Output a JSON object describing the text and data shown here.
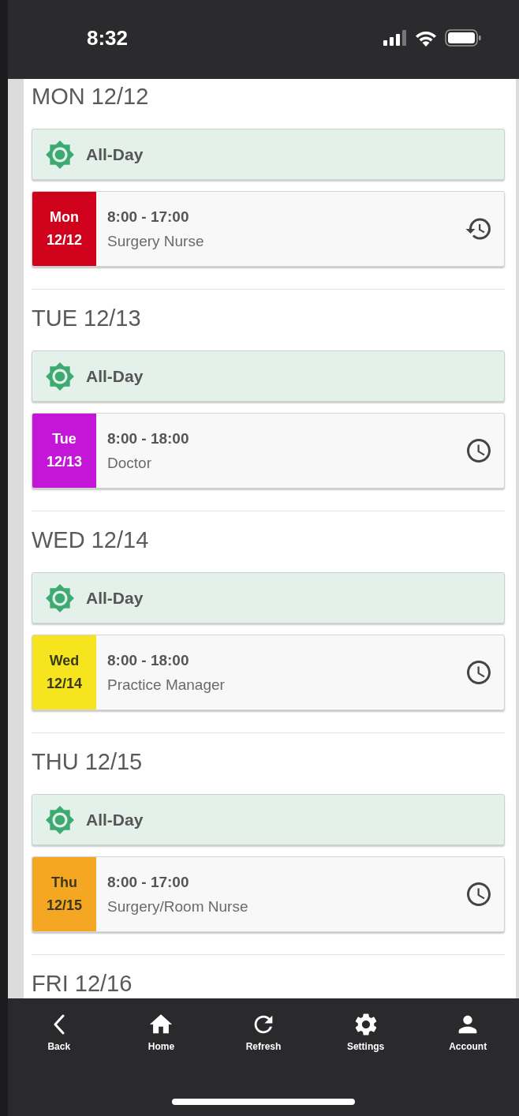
{
  "status_bar": {
    "time": "8:32"
  },
  "days": [
    {
      "heading": "MON 12/12",
      "all_day": {
        "label": "All-Day"
      },
      "shift": {
        "day": "Mon",
        "date": "12/12",
        "color": "#d0021b",
        "time": "8:00 - 17:00",
        "role": "Surgery Nurse",
        "kind": "history"
      }
    },
    {
      "heading": "TUE 12/13",
      "all_day": {
        "label": "All-Day"
      },
      "shift": {
        "day": "Tue",
        "date": "12/13",
        "color": "#c416d6",
        "time": "8:00 - 18:00",
        "role": "Doctor",
        "kind": "clock"
      }
    },
    {
      "heading": "WED 12/14",
      "all_day": {
        "label": "All-Day"
      },
      "shift": {
        "day": "Wed",
        "date": "12/14",
        "color": "#f6e51e",
        "time": "8:00 - 18:00",
        "role": "Practice Manager",
        "kind": "clock"
      }
    },
    {
      "heading": "THU 12/15",
      "all_day": {
        "label": "All-Day"
      },
      "shift": {
        "day": "Thu",
        "date": "12/15",
        "color": "#f5a623",
        "time": "8:00 - 17:00",
        "role": "Surgery/Room Nurse",
        "kind": "clock"
      }
    },
    {
      "heading": "FRI 12/16"
    }
  ],
  "nav": [
    {
      "label": "Back",
      "kind": "back"
    },
    {
      "label": "Home",
      "kind": "home"
    },
    {
      "label": "Refresh",
      "kind": "refresh"
    },
    {
      "label": "Settings",
      "kind": "settings"
    },
    {
      "label": "Account",
      "kind": "account"
    }
  ]
}
